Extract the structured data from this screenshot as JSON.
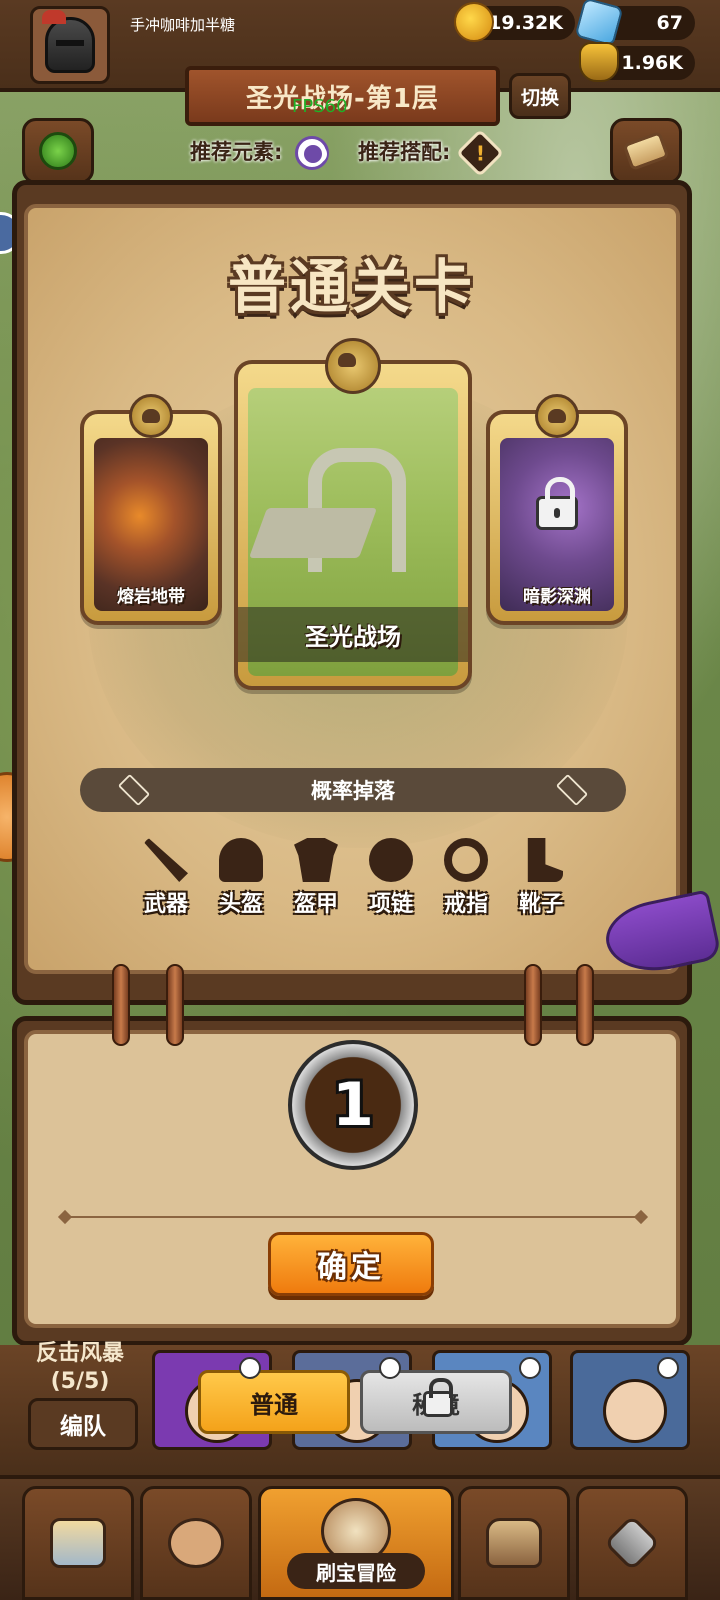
{
  "player": {
    "name": "手冲咖啡加半糖"
  },
  "resources": {
    "gold": "119.32K",
    "gems": "67",
    "potion": "1.96K"
  },
  "stage": {
    "banner": "圣光战场-第1层",
    "fps": "FPS60",
    "switch_label": "切换",
    "recommend_element_label": "推荐元素:",
    "recommend_match_label": "推荐搭配:"
  },
  "panel": {
    "title": "普通关卡",
    "levels": [
      {
        "name": "熔岩地带",
        "locked": false
      },
      {
        "name": "圣光战场",
        "locked": false,
        "selected": true
      },
      {
        "name": "暗影深渊",
        "locked": true
      }
    ],
    "drop_label": "概率掉落",
    "drops": [
      "武器",
      "头盔",
      "盔甲",
      "项链",
      "戒指",
      "靴子"
    ]
  },
  "lower": {
    "level_number": "1",
    "confirm_label": "确定"
  },
  "team": {
    "label_line1": "反击风暴",
    "label_line2": "(5/5)",
    "formation_label": "编队",
    "mode_normal": "普通",
    "mode_secret": "秘境"
  },
  "nav": {
    "adventure_label": "刷宝冒险"
  },
  "colors": {
    "accent_orange": "#f4a21a",
    "panel_brown": "#5a3a22",
    "parchment": "#dcc298"
  }
}
